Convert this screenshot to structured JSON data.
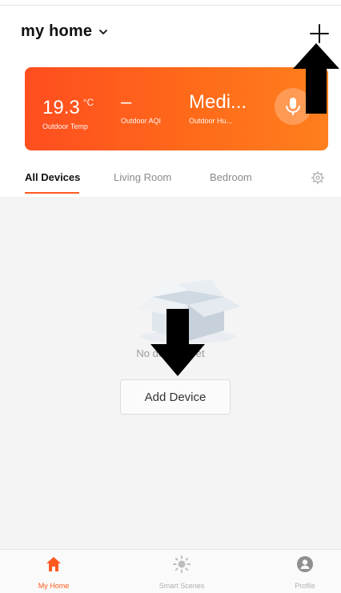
{
  "header": {
    "home_name": "my home",
    "add_icon": "plus-icon"
  },
  "weather": {
    "temp_value": "19.3",
    "temp_unit": "°C",
    "temp_label": "Outdoor Temp",
    "aqi_value": "–",
    "aqi_label": "Outdoor AQI",
    "humidity_value": "Medi...",
    "humidity_label": "Outdoor Hu...",
    "mic_icon": "microphone-icon",
    "gradient_start": "#ff4d1f",
    "gradient_end": "#ff7f1d"
  },
  "tabs": {
    "items": [
      {
        "label": "All Devices"
      },
      {
        "label": "Living Room"
      },
      {
        "label": "Bedroom"
      }
    ],
    "active_index": 0,
    "settings_icon": "gear-icon",
    "accent": "#ff5a1e"
  },
  "empty_state": {
    "illustration": "open-box-icon",
    "message": "No devices yet",
    "add_button_label": "Add Device"
  },
  "bottom_nav": {
    "items": [
      {
        "label": "My Home",
        "icon": "home-icon",
        "active": true
      },
      {
        "label": "Smart Scenes",
        "icon": "sun-icon",
        "active": false
      },
      {
        "label": "Profile",
        "icon": "profile-icon",
        "active": false
      }
    ]
  },
  "annotations": {
    "arrow_icon": "down-arrow-icon"
  }
}
